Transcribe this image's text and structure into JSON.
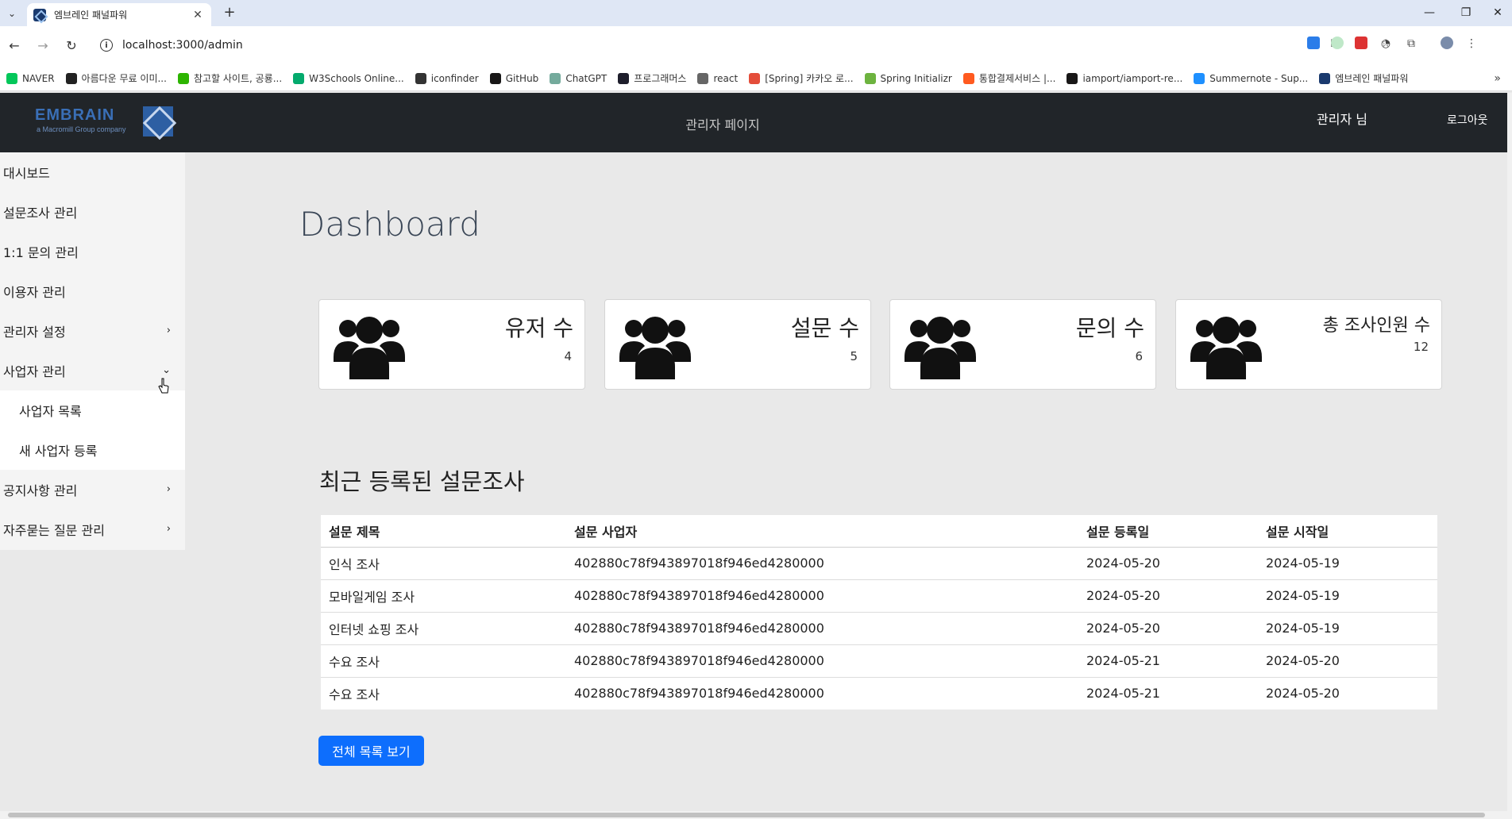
{
  "browser": {
    "tab_title": "엠브레인 패널파워",
    "url": "localhost:3000/admin",
    "bookmarks": [
      {
        "label": "NAVER",
        "color": "#03c75a"
      },
      {
        "label": "아름다운 무료 이미...",
        "color": "#222222"
      },
      {
        "label": "참고할 사이트, 공룡...",
        "color": "#2db400"
      },
      {
        "label": "W3Schools Online...",
        "color": "#04aa6d"
      },
      {
        "label": "iconfinder",
        "color": "#333333"
      },
      {
        "label": "GitHub",
        "color": "#181717"
      },
      {
        "label": "ChatGPT",
        "color": "#74aa9c"
      },
      {
        "label": "프로그래머스",
        "color": "#1e1e2c"
      },
      {
        "label": "react",
        "color": "#666666"
      },
      {
        "label": "[Spring] 카카오 로...",
        "color": "#e44d3a"
      },
      {
        "label": "Spring Initializr",
        "color": "#6db33f"
      },
      {
        "label": "통합결제서비스 |...",
        "color": "#ff5a1f"
      },
      {
        "label": "iamport/iamport-re...",
        "color": "#181717"
      },
      {
        "label": "Summernote - Sup...",
        "color": "#1e90ff"
      },
      {
        "label": "엠브레인 패널파워",
        "color": "#1a3a6e"
      }
    ]
  },
  "header": {
    "logo_text": "EMBRAIN",
    "logo_sub": "a Macromill Group company",
    "title": "관리자 페이지",
    "user": "관리자 님",
    "logout": "로그아웃"
  },
  "sidebar": {
    "items": [
      {
        "label": "대시보드"
      },
      {
        "label": "설문조사 관리"
      },
      {
        "label": "1:1 문의 관리"
      },
      {
        "label": "이용자 관리"
      },
      {
        "label": "관리자 설정",
        "chevron": "›"
      },
      {
        "label": "사업자 관리",
        "chevron": "⌄"
      }
    ],
    "sub_items": [
      {
        "label": "사업자 목록"
      },
      {
        "label": "새 사업자 등록"
      }
    ],
    "items_after": [
      {
        "label": "공지사항 관리",
        "chevron": "›"
      },
      {
        "label": "자주묻는 질문 관리",
        "chevron": "›"
      }
    ]
  },
  "main": {
    "title": "Dashboard",
    "cards": [
      {
        "label": "유저 수",
        "value": "4"
      },
      {
        "label": "설문 수",
        "value": "5"
      },
      {
        "label": "문의 수",
        "value": "6"
      },
      {
        "label": "총 조사인원 수",
        "value": "12"
      }
    ],
    "section_title": "최근 등록된 설문조사",
    "table": {
      "headers": [
        "설문 제목",
        "설문 사업자",
        "설문 등록일",
        "설문 시작일"
      ],
      "rows": [
        [
          "인식 조사",
          "402880c78f943897018f946ed4280000",
          "2024-05-20",
          "2024-05-19"
        ],
        [
          "모바일게임 조사",
          "402880c78f943897018f946ed4280000",
          "2024-05-20",
          "2024-05-19"
        ],
        [
          "인터넷 쇼핑 조사",
          "402880c78f943897018f946ed4280000",
          "2024-05-20",
          "2024-05-19"
        ],
        [
          "수요 조사",
          "402880c78f943897018f946ed4280000",
          "2024-05-21",
          "2024-05-20"
        ],
        [
          "수요 조사",
          "402880c78f943897018f946ed4280000",
          "2024-05-21",
          "2024-05-20"
        ]
      ]
    },
    "view_all_button": "전체 목록 보기"
  },
  "colors": {
    "header_bg": "#212529",
    "primary": "#0d6efd",
    "page_bg": "#e9e9e9"
  }
}
